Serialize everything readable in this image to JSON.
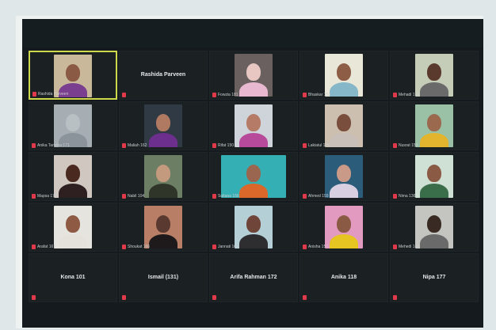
{
  "meeting": {
    "participants": [
      {
        "id": "p1",
        "name": "Rashida Parveen",
        "video": true,
        "active": true,
        "bg": "#c9b99a",
        "skin": "#8a5a44",
        "cloth": "#7a3f8e"
      },
      {
        "id": "p2",
        "name": "Rashida Parveen",
        "video": false
      },
      {
        "id": "p3",
        "name": "Fowzia 181",
        "video": true,
        "bg": "#6b6060",
        "skin": "#e8c7c2",
        "cloth": "#e8b8d0"
      },
      {
        "id": "p4",
        "name": "Bhaskar 153",
        "video": true,
        "bg": "#e9e7d8",
        "skin": "#8e5d45",
        "cloth": "#86b7c9"
      },
      {
        "id": "p5",
        "name": "Mehadi 173",
        "video": true,
        "bg": "#c5ccb8",
        "skin": "#5a3a2c",
        "cloth": "#6a6a6a"
      },
      {
        "id": "p6",
        "name": "Anika Tanzina 171",
        "video": true,
        "bg": "#a6aeb4",
        "skin": "#b9c0c4",
        "cloth": "#8a949a"
      },
      {
        "id": "p7",
        "name": "Maliah 162",
        "video": true,
        "bg": "#2f3a44",
        "skin": "#b07a62",
        "cloth": "#6d2f8e"
      },
      {
        "id": "p8",
        "name": "Rifat 150",
        "video": true,
        "bg": "#cfd4db",
        "skin": "#b57b66",
        "cloth": "#b84a9c"
      },
      {
        "id": "p9",
        "name": "Lakiatul 156",
        "video": true,
        "bg": "#cdbfb0",
        "skin": "#7a4e3c",
        "cloth": "#c8c0b8"
      },
      {
        "id": "p10",
        "name": "Nusrat 153",
        "video": true,
        "bg": "#9ac1a6",
        "skin": "#9b6a4e",
        "cloth": "#e3b52e"
      },
      {
        "id": "p11",
        "name": "Mapsa 174",
        "video": true,
        "bg": "#cfc7c0",
        "skin": "#4a2a20",
        "cloth": "#2e2020"
      },
      {
        "id": "p12",
        "name": "Nabil 104",
        "video": true,
        "bg": "#6c7e63",
        "skin": "#c49a7e",
        "cloth": "#2f3528"
      },
      {
        "id": "p13",
        "name": "Sultana 166",
        "video": true,
        "wide": true,
        "bg": "#34b0b4",
        "skin": "#9a6650",
        "cloth": "#d9682a"
      },
      {
        "id": "p14",
        "name": "Ahmed 159",
        "video": true,
        "bg": "#2b5d7a",
        "skin": "#c99a88",
        "cloth": "#d8d0e0"
      },
      {
        "id": "p15",
        "name": "Nima 136",
        "video": true,
        "bg": "#cfe0d4",
        "skin": "#8a5a44",
        "cloth": "#3a6e4a"
      },
      {
        "id": "p16",
        "name": "Arafat 167",
        "video": true,
        "bg": "#e6e4df",
        "skin": "#8e5a44",
        "cloth": "#e5e2dc"
      },
      {
        "id": "p17",
        "name": "Shoukat 166",
        "video": true,
        "bg": "#b87f66",
        "skin": "#5a3a30",
        "cloth": "#1e1a1c"
      },
      {
        "id": "p18",
        "name": "Jannati 161",
        "video": true,
        "bg": "#b5cfd6",
        "skin": "#6e4538",
        "cloth": "#2e2e30"
      },
      {
        "id": "p19",
        "name": "Anisha 157",
        "video": true,
        "bg": "#e29ac0",
        "skin": "#8a5a44",
        "cloth": "#e6c422"
      },
      {
        "id": "p20",
        "name": "Mehedi 165",
        "video": true,
        "bg": "#c4c4c0",
        "skin": "#3a2a24",
        "cloth": "#6a6a6a"
      },
      {
        "id": "p21",
        "name": "Kona 101",
        "video": false
      },
      {
        "id": "p22",
        "name": "Ismail (131)",
        "video": false
      },
      {
        "id": "p23",
        "name": "Arifa Rahman 172",
        "video": false
      },
      {
        "id": "p24",
        "name": "Anika 118",
        "video": false
      },
      {
        "id": "p25",
        "name": "Nipa 177",
        "video": false
      }
    ],
    "muted_icon": "mic-muted-icon",
    "active_border_color": "#cfd84a",
    "mute_color": "#e0394a"
  }
}
